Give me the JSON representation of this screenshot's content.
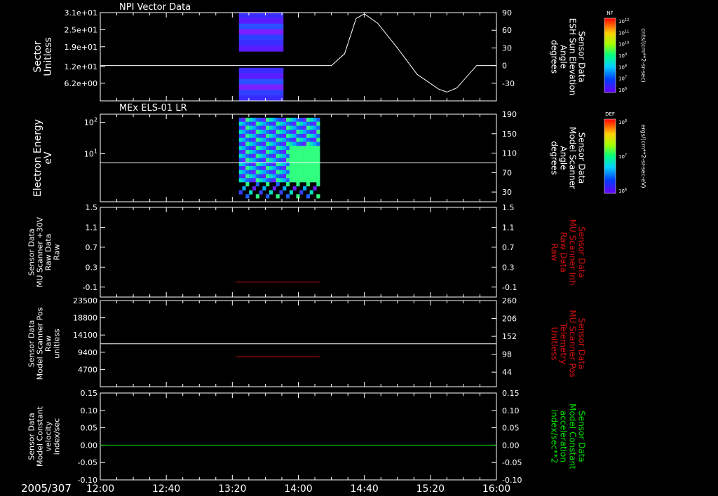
{
  "colors": {
    "background": "#000000",
    "axes": "#ffffff",
    "red": "#d01010",
    "green": "#00e000"
  },
  "panel_titles": [
    "NPI Vector Data",
    "MEx ELS-01 LR"
  ],
  "date_label": "2005/307",
  "chart_data": [
    {
      "type": "heatmap",
      "name": "NPI Vector Data",
      "ylabel": "Sector\nUnitless",
      "yticks": [
        "3.1e+01",
        "2.5e+01",
        "1.9e+01",
        "1.2e+01",
        "6.2e+00"
      ],
      "ylabel_right": "Sensor Data\nESH Sun Elevation\nAngle\ndegrees",
      "yticks_right": [
        "90",
        "60",
        "30",
        "0",
        "-30"
      ],
      "overlay_line": {
        "description": "sun elevation",
        "points": [
          [
            "12:00",
            0
          ],
          [
            "14:20",
            0
          ],
          [
            "14:28",
            20
          ],
          [
            "14:35",
            80
          ],
          [
            "14:40",
            88
          ],
          [
            "14:48",
            72
          ],
          [
            "15:00",
            30
          ],
          [
            "15:12",
            -15
          ],
          [
            "15:25",
            -40
          ],
          [
            "15:30",
            -45
          ],
          [
            "15:36",
            -38
          ],
          [
            "15:48",
            0
          ],
          [
            "16:00",
            0
          ]
        ]
      },
      "data_extent": {
        "start": "13:24",
        "end": "13:51"
      },
      "colorbar": {
        "label": "NF",
        "units": "cnts/(cm**2-sr-sec)",
        "ticks": [
          "10^12",
          "10^11",
          "10^10",
          "10^9",
          "10^8",
          "10^7",
          "10^6"
        ]
      }
    },
    {
      "type": "heatmap",
      "name": "MEx ELS-01 LR",
      "ylabel": "Electron Energy\neV",
      "yticks": [
        "10^2",
        "10^1"
      ],
      "ylabel_right": "Sensor Data\nModel Scanner\nAngle\ndegrees",
      "yticks_right": [
        "190",
        "150",
        "110",
        "70",
        "30"
      ],
      "overlay_line": {
        "description": "scanner angle",
        "value": 90
      },
      "data_extent": {
        "start": "13:24",
        "end": "14:13"
      },
      "colorbar": {
        "label": "DEF",
        "units": "ergs/(cm**2-sr-sec-eV)",
        "ticks": [
          "10^8",
          "10^7",
          "10^6"
        ]
      }
    },
    {
      "type": "line",
      "ylabel": "Sensor Data\nMU Scanner +30V\nRaw Data\nRaw",
      "yticks": [
        "1.5",
        "1.1",
        "0.7",
        "0.3",
        "-0.1"
      ],
      "ylabel_right": "Sensor Data\nMU Scanner Inh\nRaw Data\nRaw",
      "yticks_right": [
        "1.5",
        "1.1",
        "0.7",
        "0.3",
        "-0.1"
      ],
      "series": [
        {
          "color": "#d01010",
          "axis": "right",
          "x": [
            "13:22",
            "14:13"
          ],
          "y": [
            0.0,
            0.0
          ]
        }
      ]
    },
    {
      "type": "line",
      "ylabel": "Sensor Data\nModel Scanner Pos\nRaw\nunitless",
      "yticks": [
        "23500",
        "18800",
        "14100",
        "9400",
        "4700"
      ],
      "ylabel_right": "Sensor Data\nMU Scanner Pos\nTelemetry\nUnitless",
      "yticks_right": [
        "260",
        "206",
        "152",
        "98",
        "44"
      ],
      "series": [
        {
          "color": "#ffffff",
          "axis": "left",
          "x": [
            "12:00",
            "16:00"
          ],
          "y": [
            11700,
            11700
          ]
        },
        {
          "color": "#d01010",
          "axis": "right",
          "x": [
            "13:22",
            "14:13"
          ],
          "y": [
            90,
            90
          ]
        }
      ]
    },
    {
      "type": "line",
      "ylabel": "Sensor Data\nModel Constant\nvelocity\nindex/sec",
      "yticks": [
        "0.15",
        "0.10",
        "0.05",
        "0.00",
        "-0.05",
        "-0.10"
      ],
      "ylabel_right": "Sensor Data\nModel Constant\nacceleration\nindex/sec**2",
      "yticks_right": [
        "0.15",
        "0.10",
        "0.05",
        "0.00",
        "-0.05",
        "-0.10"
      ],
      "series": [
        {
          "color": "#00e000",
          "axis": "left",
          "x": [
            "12:00",
            "16:00"
          ],
          "y": [
            0.0,
            0.0
          ]
        }
      ]
    }
  ],
  "time_axis": {
    "ticks": [
      "12:00",
      "12:40",
      "13:20",
      "14:00",
      "14:40",
      "15:20",
      "16:00"
    ]
  }
}
